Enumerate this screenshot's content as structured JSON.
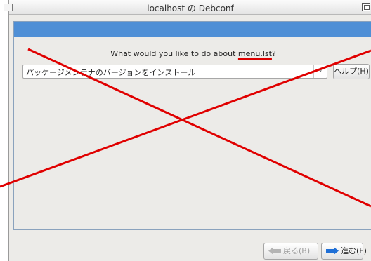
{
  "window": {
    "title": "localhost の Debconf"
  },
  "dialog": {
    "question_prefix": "What would you like to do about ",
    "question_term": "menu.lst",
    "question_suffix": "?",
    "choice": {
      "selected": "パッケージメンテナのバージョンをインストール"
    },
    "help_label": "ヘルプ(H)"
  },
  "nav": {
    "back_label": "戻る(B)",
    "next_label": "進む(F)"
  },
  "colors": {
    "banner": "#4f8fd6",
    "cross": "#e00000",
    "arrow_active": "#1f6fd6",
    "arrow_disabled": "#a9a9a9"
  },
  "icons": {
    "window_menu": "window-menu-icon",
    "maximize": "maximize-icon",
    "dropdown": "chevron-down-icon",
    "back": "arrow-left-icon",
    "next": "arrow-right-icon"
  }
}
